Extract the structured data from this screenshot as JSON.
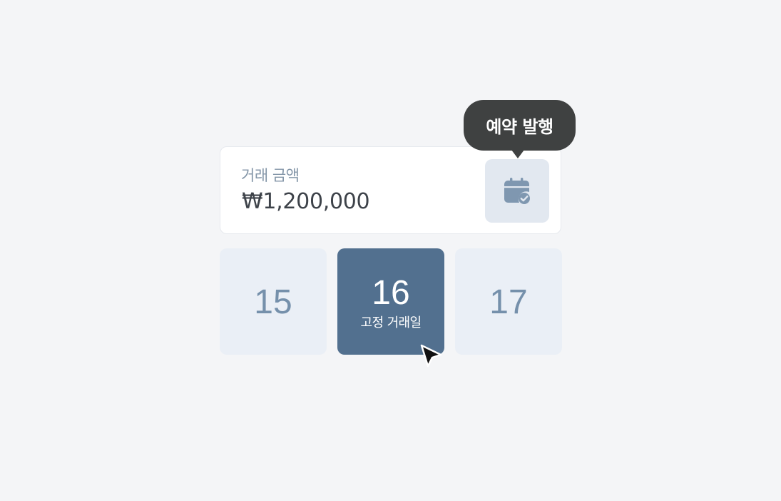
{
  "amount_card": {
    "label": "거래 금액",
    "value": "₩1,200,000"
  },
  "schedule_button": {
    "icon": "calendar-check-icon"
  },
  "tooltip": {
    "text": "예약 발행"
  },
  "dates": [
    {
      "day": "15",
      "selected": false
    },
    {
      "day": "16",
      "selected": true,
      "sub_label": "고정 거래일"
    },
    {
      "day": "17",
      "selected": false
    }
  ],
  "colors": {
    "background": "#f4f5f7",
    "selected_tile": "#52708f",
    "unselected_tile": "#eaeff6",
    "tooltip_bg": "#3f4141",
    "icon_color": "#7f97b0"
  }
}
